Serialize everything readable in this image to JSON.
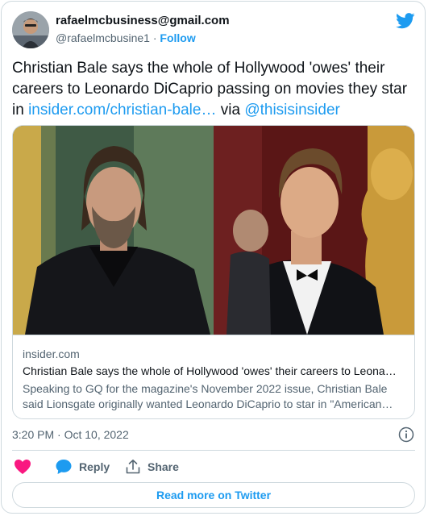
{
  "author": {
    "name": "rafaelmcbusiness@gmail.com",
    "handle": "@rafaelmcbusine1",
    "separator": "·",
    "follow_label": "Follow"
  },
  "tweet": {
    "text_before": "Christian Bale says the whole of Hollywood 'owes' their careers to Leonardo DiCaprio passing on movies they star in ",
    "link_text": "insider.com/christian-bale…",
    "via_text": " via ",
    "mention": "@thisisinsider"
  },
  "card": {
    "domain": "insider.com",
    "title": "Christian Bale says the whole of Hollywood 'owes' their careers to Leona…",
    "description_line1": "Speaking to GQ for the magazine's November 2022 issue, Christian Bale",
    "description_line2": "said Lionsgate originally wanted Leonardo DiCaprio to star in \"American…"
  },
  "timestamp": "3:20 PM · Oct 10, 2022",
  "actions": {
    "reply_label": "Reply",
    "share_label": "Share"
  },
  "read_more_label": "Read more on Twitter",
  "colors": {
    "accent": "#1d9bf0",
    "like": "#f91880",
    "muted": "#536471",
    "border": "#cfd9de"
  },
  "icons": [
    "twitter-bird-icon",
    "info-icon",
    "heart-icon",
    "reply-bubble-icon",
    "share-icon"
  ]
}
